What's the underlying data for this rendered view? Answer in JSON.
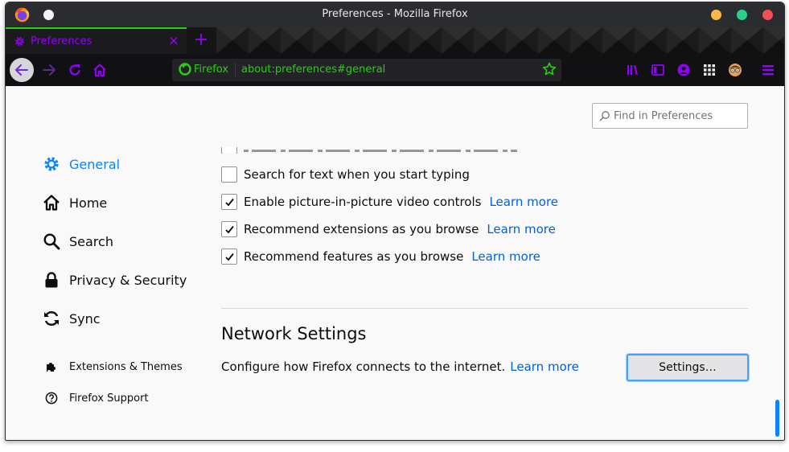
{
  "window": {
    "title": "Preferences - Mozilla Firefox",
    "controls": {
      "minimize_color": "#f6b94c",
      "maximize_color": "#2ad089",
      "close_color": "#ef4f57"
    }
  },
  "tabs": [
    {
      "label": "Preferences",
      "icon": "gear-icon",
      "active": true,
      "close_label": "×"
    }
  ],
  "new_tab_label": "+",
  "navbar": {
    "identity_label": "Firefox",
    "url": "about:preferences#general",
    "toolbar_icons": [
      "library-icon",
      "sidebar-icon",
      "account-icon",
      "extensions-grid-icon",
      "avatar-icon",
      "menu-icon"
    ]
  },
  "search": {
    "placeholder": "Find in Preferences",
    "value": ""
  },
  "categories": [
    {
      "label": "General",
      "icon": "gear-icon",
      "selected": true
    },
    {
      "label": "Home",
      "icon": "home-icon",
      "selected": false
    },
    {
      "label": "Search",
      "icon": "search-icon",
      "selected": false
    },
    {
      "label": "Privacy & Security",
      "icon": "lock-icon",
      "selected": false
    },
    {
      "label": "Sync",
      "icon": "sync-icon",
      "selected": false
    }
  ],
  "footer_categories": [
    {
      "label": "Extensions & Themes",
      "icon": "puzzle-icon"
    },
    {
      "label": "Firefox Support",
      "icon": "help-icon"
    }
  ],
  "browsing_options": [
    {
      "label": "Search for text when you start typing",
      "checked": false,
      "link": ""
    },
    {
      "label": "Enable picture-in-picture video controls",
      "checked": true,
      "link": "Learn more"
    },
    {
      "label": "Recommend extensions as you browse",
      "checked": true,
      "link": "Learn more"
    },
    {
      "label": "Recommend features as you browse",
      "checked": true,
      "link": "Learn more"
    }
  ],
  "network": {
    "title": "Network Settings",
    "description": "Configure how Firefox connects to the internet.",
    "link": "Learn more",
    "button_label": "Settings…"
  },
  "colors": {
    "accent_green": "#23d20c",
    "accent_purple": "#9400ff",
    "selected_blue": "#0a84ff",
    "link_blue": "#0060df"
  }
}
